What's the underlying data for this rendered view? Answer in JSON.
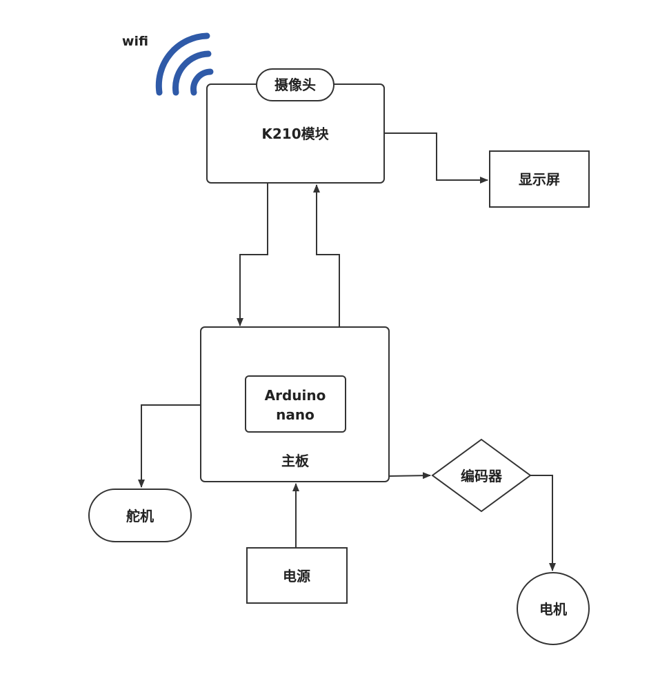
{
  "wifi": {
    "label": "wifi",
    "icon": "wifi-icon",
    "color": "#2f5aa8"
  },
  "nodes": {
    "camera": "摄像头",
    "k210": "K210模块",
    "display": "显示屏",
    "arduino_line1": "Arduino",
    "arduino_line2": "nano",
    "mainboard": "主板",
    "servo": "舵机",
    "encoder": "编码器",
    "power": "电源",
    "motor": "电机"
  },
  "colors": {
    "stroke": "#333333",
    "text": "#222222",
    "background": "#ffffff"
  }
}
